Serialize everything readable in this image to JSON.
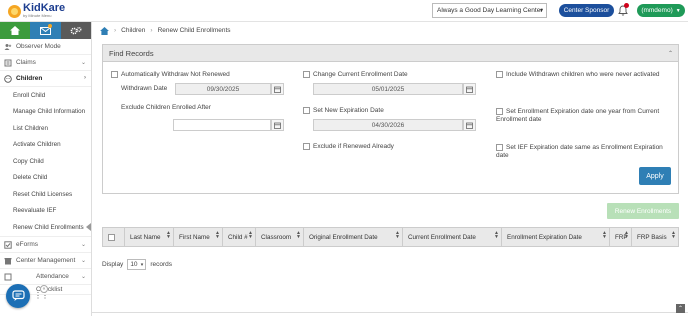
{
  "header": {
    "logo_name": "KidKare",
    "logo_sub": "by Minute Menu",
    "center_select": "Always a Good Day Learning Center",
    "center_sponsor_button": "Center Sponsor",
    "user_button": "(mmdemo)"
  },
  "sidebar": {
    "items_top": [
      {
        "label": "Observer Mode"
      },
      {
        "label": "Claims"
      },
      {
        "label": "Children"
      }
    ],
    "children_sub": [
      "Enroll Child",
      "Manage Child Information",
      "List Children",
      "Activate Children",
      "Copy Child",
      "Delete Child",
      "Reset Child Licenses",
      "Reevaluate IEF",
      "Renew Child Enrollments"
    ],
    "items_bottom": [
      {
        "label": "eForms"
      },
      {
        "label": "Center Management"
      },
      {
        "label": "Attendance"
      },
      {
        "label": "Checklist"
      }
    ]
  },
  "breadcrumb": {
    "children": "Children",
    "current": "Renew Child Enrollments"
  },
  "find_records": {
    "title": "Find Records",
    "auto_withdraw_label": "Automatically Withdraw Not Renewed",
    "withdrawn_date_label": "Withdrawn Date",
    "withdrawn_date_value": "09/30/2025",
    "exclude_enrolled_after_label": "Exclude Children Enrolled After",
    "exclude_enrolled_after_value": "",
    "change_enrollment_label": "Change Current Enrollment Date",
    "change_enrollment_value": "05/01/2025",
    "set_expiration_label": "Set New Expiration Date",
    "set_expiration_value": "04/30/2026",
    "exclude_renewed_label": "Exclude if Renewed Already",
    "include_withdrawn_label": "Include Withdrawn children who were never activated",
    "set_expiration_one_year_label": "Set Enrollment Expiration date one year from Current Enrollment date",
    "set_ief_label": "Set IEF Expiration date same as Enrollment Expiration date",
    "apply_button": "Apply"
  },
  "renew_button": "Renew Enrollments",
  "table": {
    "columns": [
      "Last Name",
      "First Name",
      "Child #",
      "Classroom",
      "Original Enrollment Date",
      "Current Enrollment Date",
      "Enrollment Expiration Date",
      "FRP",
      "FRP Basis"
    ]
  },
  "display": {
    "prefix": "Display",
    "value": "10",
    "suffix": "records"
  },
  "colors": {
    "primary_blue": "#1c4f9c",
    "green": "#1f9a58",
    "apply_blue": "#2f7fb5",
    "renew_disabled": "#b8e0b8"
  }
}
